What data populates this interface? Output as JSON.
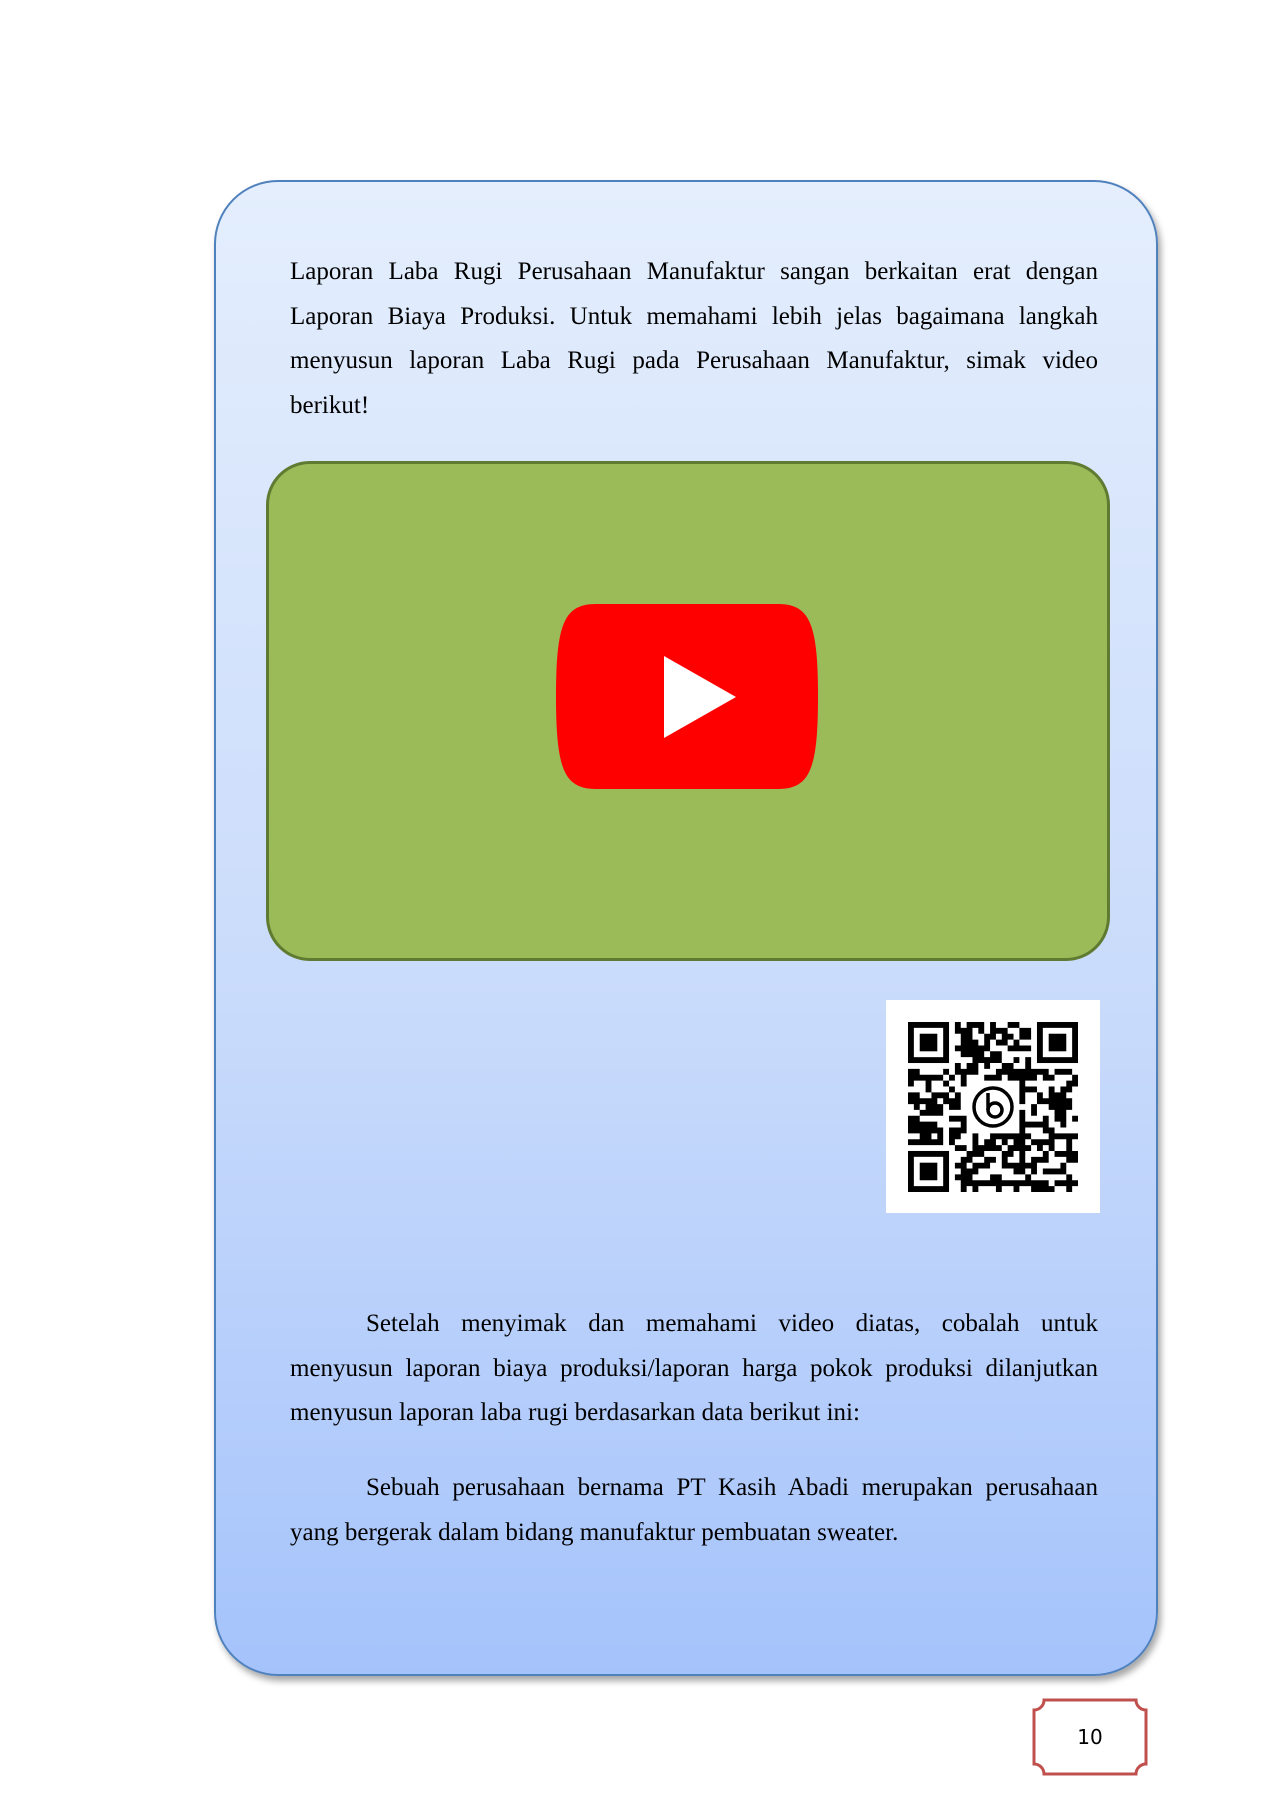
{
  "body": {
    "intro": "Laporan Laba Rugi Perusahaan Manufaktur sangan berkaitan erat dengan Laporan Biaya Produksi. Untuk memahami lebih jelas bagaimana langkah menyusun laporan Laba Rugi pada Perusahaan Manufaktur, simak video berikut!",
    "instruction": "Setelah menyimak dan memahami video diatas, cobalah untuk menyusun laporan biaya produksi/laporan harga pokok produksi dilanjutkan menyusun laporan laba rugi berdasarkan data berikut ini:",
    "case": "Sebuah perusahaan bernama PT Kasih Abadi merupakan perusahaan yang bergerak dalam bidang manufaktur pembuatan sweater."
  },
  "video": {
    "icon": "youtube-play-icon",
    "icon_color": "#ff0000",
    "box_color": "#9bbb59"
  },
  "qr": {
    "icon": "qr-code",
    "center_logo": "bitly-logo-icon"
  },
  "page": {
    "number": "10"
  },
  "colors": {
    "card_border": "#4f81bd",
    "page_frame": "#c0504d"
  }
}
